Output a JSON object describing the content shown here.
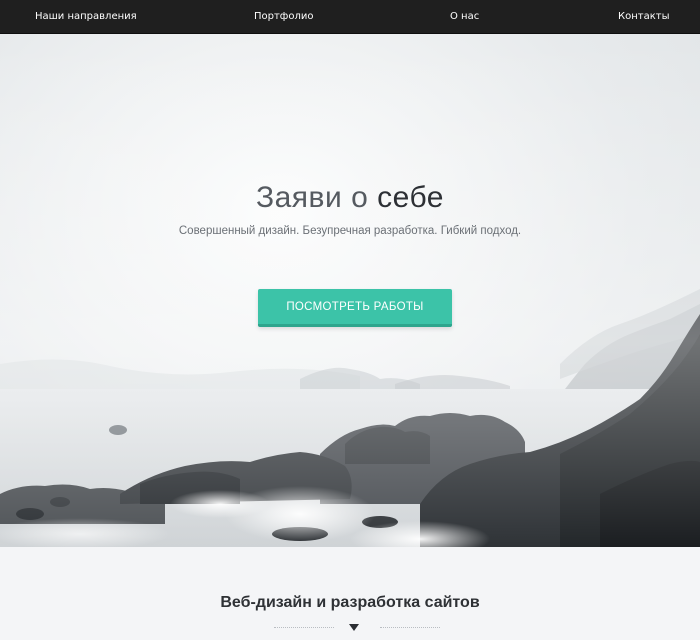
{
  "nav": {
    "items": [
      {
        "label": "Наши направления"
      },
      {
        "label": "Портфолио"
      },
      {
        "label": "О нас"
      },
      {
        "label": "Контакты"
      }
    ]
  },
  "hero": {
    "title_light": "Заяви о ",
    "title_strong": "себе",
    "subtitle": "Совершенный дизайн. Безупречная разработка. Гибкий подход.",
    "cta_label": "ПОСМОТРЕТЬ РАБОТЫ"
  },
  "section": {
    "title": "Веб-дизайн и разработка сайтов"
  },
  "colors": {
    "nav_bg": "#1f1f1f",
    "accent": "#3cc3a8",
    "page_bg": "#f4f5f7"
  },
  "icons": {
    "divider_arrow": "triangle-down"
  }
}
